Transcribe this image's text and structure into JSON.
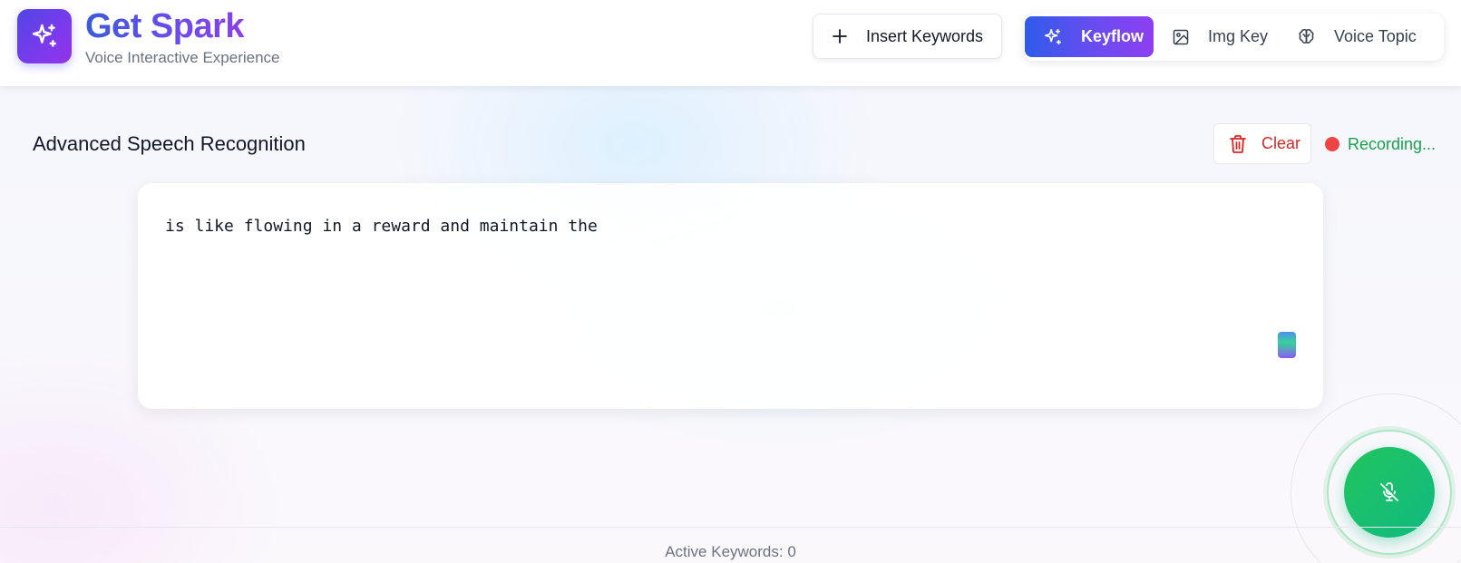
{
  "app": {
    "title": "Get Spark",
    "subtitle": "Voice Interactive Experience",
    "logo_icon": "sparkles-icon"
  },
  "header": {
    "insert_button": {
      "label": "Insert Keywords",
      "icon": "plus-icon"
    },
    "modes": [
      {
        "label": "Keyflow",
        "icon": "sparkles-icon",
        "active": true
      },
      {
        "label": "Img Key",
        "icon": "image-icon",
        "active": false
      },
      {
        "label": "Voice Topic",
        "icon": "brain-icon",
        "active": false
      }
    ]
  },
  "section": {
    "title": "Advanced Speech Recognition",
    "clear_label": "Clear",
    "clear_icon": "trash-icon",
    "status_text": "Recording..."
  },
  "transcript": {
    "text": "is like flowing in a reward and maintain the"
  },
  "mic": {
    "icon": "mic-off-icon"
  },
  "footer": {
    "active_keywords": "Active Keywords: 0"
  },
  "colors": {
    "accent_gradient_start": "#2f5bea",
    "accent_gradient_end": "#8d3ff0",
    "danger": "#dc2626",
    "recording_dot": "#ef4444",
    "status_green": "#16a34a",
    "mic_green": "#22c55e"
  }
}
